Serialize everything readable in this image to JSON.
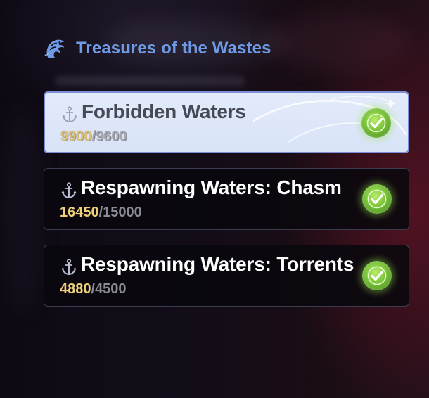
{
  "header": {
    "title": "Treasures of the Wastes",
    "icon": "dragon-emblem-icon"
  },
  "quests": [
    {
      "title": "Forbidden Waters",
      "current": "9900",
      "separator": "/",
      "target": "9600",
      "progress_fraction": 1.0,
      "completed": true,
      "selected": true,
      "icon": "anchor-icon"
    },
    {
      "title": "Respawning Waters: Chasm",
      "current": "16450",
      "separator": "/",
      "target": "15000",
      "progress_fraction": 1.0,
      "completed": true,
      "selected": false,
      "icon": "anchor-icon"
    },
    {
      "title": "Respawning Waters: Torrents",
      "current": "4880",
      "separator": "/",
      "target": "4500",
      "progress_fraction": 1.0,
      "completed": true,
      "selected": false,
      "icon": "anchor-icon"
    }
  ],
  "colors": {
    "header_title": "#6f9be6",
    "current_value": "#f0cf7b",
    "target_value": "#8a8c94",
    "check_green": "#78c23a",
    "selected_border": "#7c8fd6"
  }
}
